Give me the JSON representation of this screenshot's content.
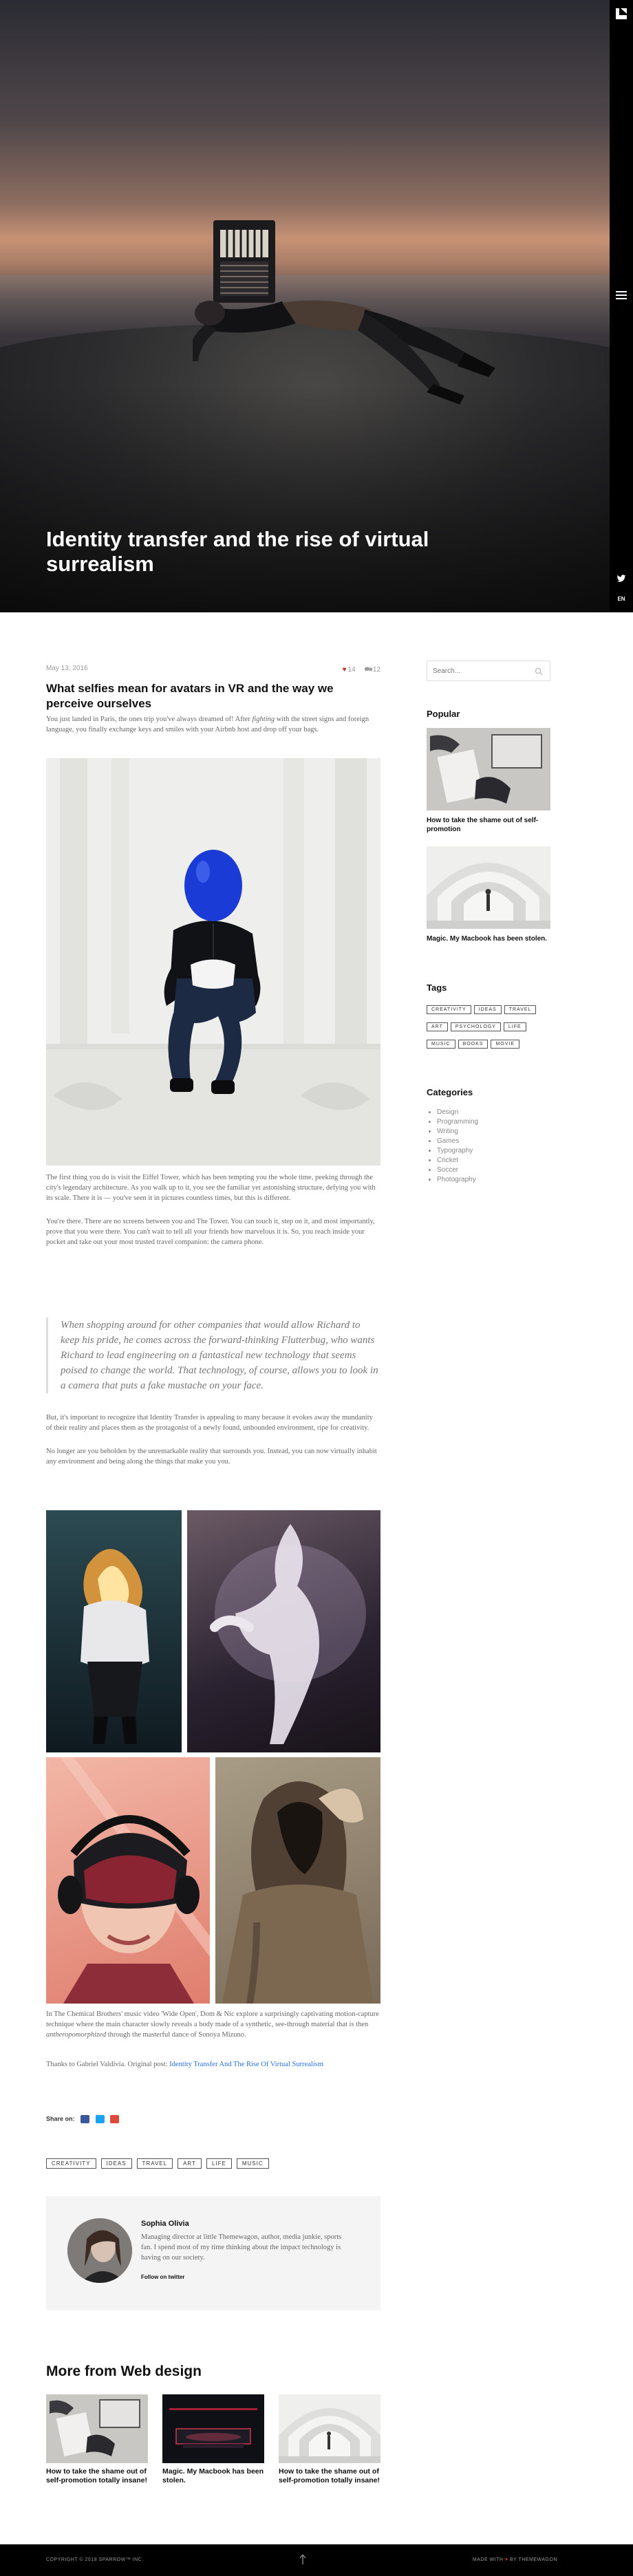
{
  "hero": {
    "title": "Identity transfer and the rise of virtual surrealism"
  },
  "sidebar_bar": {
    "logo_icon": "logo-icon",
    "menu_icon": "hamburger-menu-icon",
    "twitter_icon": "twitter-icon",
    "language": "EN"
  },
  "post": {
    "date": "May 13, 2016",
    "likes": "14",
    "comments": "12",
    "heading": "What selfies mean for avatars in VR and the way we perceive ourselves",
    "intro_a": "You just landed in Paris, the ones trip you've always dreamed of! After ",
    "intro_em": "fighting",
    "intro_b": " with the street signs and foreign language, you finally exchange keys and smiles with your Airbnb host and drop off your bags.",
    "p1": "The first thing you do is visit the Eiffel Tower, which has been tempting you the whole time, peeking through the city's legendary architecture. As you walk up to it, you see the familiar yet astonishing structure, defying you with its scale. There it is — you've seen it in pictures countless times, but this is different.",
    "p2": "You're there. There are no screens between you and The Tower. You can touch it, step on it, and most importantly, prove that you were there. You can't wait to tell all your friends how marvelous it is. So, you reach inside your pocket and take out your most trusted travel companion: the camera phone.",
    "quote": "When shopping around for other companies that would allow Richard to keep his pride, he comes across the forward-thinking Flutterbug, who wants Richard to lead engineering on a fantastical new technology that seems poised to change the world. That technology, of course, allows you to look in a camera that puts a fake mustache on your face.",
    "p3": "But, it's important to recognize that Identity Transfer is appealing to many because it evokes away the mundanity of their reality and places them as the protagonist of a newly found, unbounded environment, ripe for creativity.",
    "p4": "No longer are you beholden by the unremarkable reality that surrounds you. Instead, you can now virtually inhabit any environment and being along the things that make you you.",
    "p5_a": "In The Chemical Brothers' music video 'Wide Open', Dom & Nic explore a surprisingly captivating motion-capture technique where the main character slowly reveals a body made of a synthetic, see-through material that is then ",
    "p5_em": "antheropomorphized",
    "p5_b": " through the masterful dance of Sonoya Mizuno.",
    "thanks_prefix": "Thanks to Gabriel Valdivia. Original post: ",
    "thanks_link": "Identity Transfer And The Rise Of Virtual Surrealism",
    "share_label": "Share on:",
    "tags": [
      "CREATIVITY",
      "IDEAS",
      "TRAVEL",
      "ART",
      "LIFE",
      "MUSIC"
    ]
  },
  "author": {
    "name": "Sophia Olivia",
    "bio": "Managing director at little Themewagon, author, media junkie, sports fan. I spend most of my time thinking about the impact technology is having on our society.",
    "follow": "Follow on twitter"
  },
  "more": {
    "title": "More from Web design",
    "cards": [
      {
        "title": "How to take the shame out of self-promotion totally insane!"
      },
      {
        "title": "Magic. My Macbook has been stolen."
      },
      {
        "title": "How to take the shame out of self-promotion totally insane!"
      }
    ]
  },
  "sidebar": {
    "search_placeholder": "Search...",
    "popular_title": "Popular",
    "popular": [
      {
        "title": "How to take the shame out of self-promotion"
      },
      {
        "title": "Magic. My Macbook has been stolen."
      }
    ],
    "tags_title": "Tags",
    "tags": [
      "CREATIVITY",
      "IDEAS",
      "TRAVEL",
      "ART",
      "PSYCHOLOGY",
      "LIFE",
      "MUSIC",
      "BOOKS",
      "MOVIE"
    ],
    "categories_title": "Categories",
    "categories": [
      "Design",
      "Programming",
      "Writing",
      "Games",
      "Typography",
      "Cricket",
      "Soccer",
      "Photography"
    ]
  },
  "footer": {
    "copyright": "COPYRIGHT © 2018 SPARROW™ INC.",
    "made_prefix": "MADE WITH ",
    "made_suffix": " BY THEMEWAGON",
    "up_icon": "arrow-up-icon"
  },
  "colors": {
    "accent_heart": "#c9282d",
    "link": "#2a6fd6",
    "bar": "#000000"
  }
}
